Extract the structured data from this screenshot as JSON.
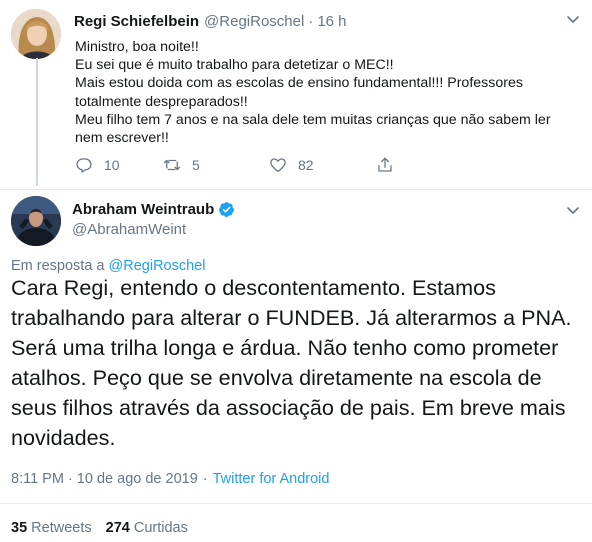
{
  "reply_tweet": {
    "author_name": "Regi Schiefelbein",
    "author_handle": "@RegiRoschel",
    "separator": "·",
    "time": "16 h",
    "lines": [
      "Ministro, boa noite!!",
      "Eu sei que é muito trabalho para detetizar o MEC!!",
      "Mais estou doida com as escolas de ensino fundamental!!! Professores totalmente despreparados!!",
      "Meu filho tem 7 anos e na sala dele tem muitas crianças que não sabem ler nem escrever!!"
    ],
    "reply_count": "10",
    "retweet_count": "5",
    "like_count": "82"
  },
  "main_tweet": {
    "author_name": "Abraham Weintraub",
    "author_handle": "@AbrahamWeint",
    "verified": true,
    "reply_to_prefix": "Em resposta a",
    "reply_to_handle": "@RegiRoschel",
    "text": "Cara Regi, entendo o descontentamento. Estamos trabalhando para alterar o FUNDEB. Já alterarmos a PNA.  Será uma trilha longa e árdua. Não tenho como prometer atalhos. Peço que se envolva diretamente na escola de seus filhos através da associação de pais. Em breve mais novidades.",
    "timestamp": "8:11 PM · 10 de ago de 2019",
    "meta_separator": "·",
    "source": "Twitter for Android",
    "retweets_count": "35",
    "retweets_label": "Retweets",
    "likes_count": "274",
    "likes_label": "Curtidas"
  },
  "colors": {
    "accent": "#1da1f2",
    "secondary_text": "#657786",
    "primary_text": "#14171a",
    "divider": "#e6ecf0"
  },
  "icons": [
    "chevron-down-icon",
    "reply-icon",
    "retweet-icon",
    "like-icon",
    "share-icon",
    "verified-badge-icon"
  ]
}
